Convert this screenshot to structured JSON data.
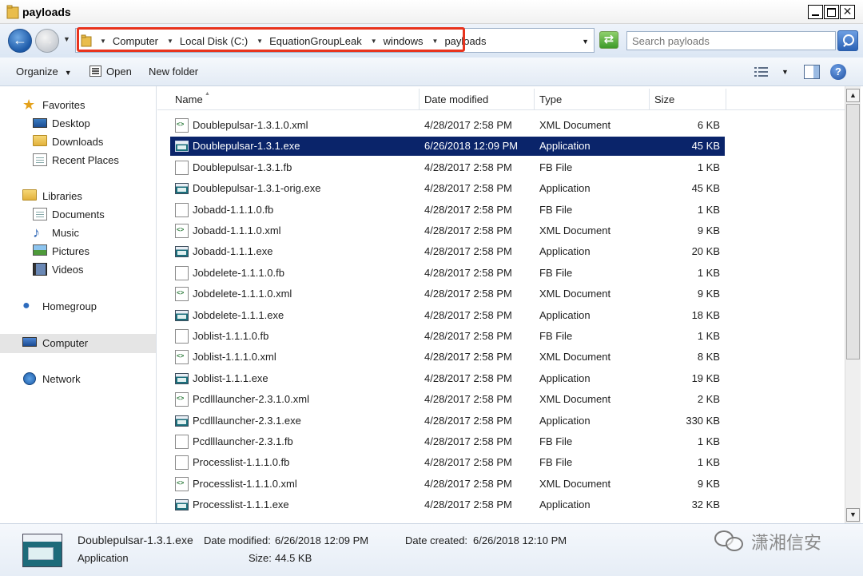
{
  "window": {
    "title": "payloads"
  },
  "address": {
    "crumbs": [
      "Computer",
      "Local Disk (C:)",
      "EquationGroupLeak",
      "windows",
      "payloads"
    ]
  },
  "search": {
    "placeholder": "Search payloads"
  },
  "toolbar": {
    "organize": "Organize",
    "open": "Open",
    "new_folder": "New folder"
  },
  "nav": {
    "favorites": "Favorites",
    "desktop": "Desktop",
    "downloads": "Downloads",
    "recent_places": "Recent Places",
    "libraries": "Libraries",
    "documents": "Documents",
    "music": "Music",
    "pictures": "Pictures",
    "videos": "Videos",
    "homegroup": "Homegroup",
    "computer": "Computer",
    "network": "Network"
  },
  "columns": {
    "name": "Name",
    "date": "Date modified",
    "type": "Type",
    "size": "Size"
  },
  "files": [
    {
      "name": "Doublepulsar-1.3.1.0.xml",
      "date": "4/28/2017 2:58 PM",
      "type": "XML Document",
      "size": "6 KB",
      "kind": "xml",
      "selected": false
    },
    {
      "name": "Doublepulsar-1.3.1.exe",
      "date": "6/26/2018 12:09 PM",
      "type": "Application",
      "size": "45 KB",
      "kind": "exe",
      "selected": true
    },
    {
      "name": "Doublepulsar-1.3.1.fb",
      "date": "4/28/2017 2:58 PM",
      "type": "FB File",
      "size": "1 KB",
      "kind": "fb",
      "selected": false
    },
    {
      "name": "Doublepulsar-1.3.1-orig.exe",
      "date": "4/28/2017 2:58 PM",
      "type": "Application",
      "size": "45 KB",
      "kind": "exe",
      "selected": false
    },
    {
      "name": "Jobadd-1.1.1.0.fb",
      "date": "4/28/2017 2:58 PM",
      "type": "FB File",
      "size": "1 KB",
      "kind": "fb",
      "selected": false
    },
    {
      "name": "Jobadd-1.1.1.0.xml",
      "date": "4/28/2017 2:58 PM",
      "type": "XML Document",
      "size": "9 KB",
      "kind": "xml",
      "selected": false
    },
    {
      "name": "Jobadd-1.1.1.exe",
      "date": "4/28/2017 2:58 PM",
      "type": "Application",
      "size": "20 KB",
      "kind": "exe",
      "selected": false
    },
    {
      "name": "Jobdelete-1.1.1.0.fb",
      "date": "4/28/2017 2:58 PM",
      "type": "FB File",
      "size": "1 KB",
      "kind": "fb",
      "selected": false
    },
    {
      "name": "Jobdelete-1.1.1.0.xml",
      "date": "4/28/2017 2:58 PM",
      "type": "XML Document",
      "size": "9 KB",
      "kind": "xml",
      "selected": false
    },
    {
      "name": "Jobdelete-1.1.1.exe",
      "date": "4/28/2017 2:58 PM",
      "type": "Application",
      "size": "18 KB",
      "kind": "exe",
      "selected": false
    },
    {
      "name": "Joblist-1.1.1.0.fb",
      "date": "4/28/2017 2:58 PM",
      "type": "FB File",
      "size": "1 KB",
      "kind": "fb",
      "selected": false
    },
    {
      "name": "Joblist-1.1.1.0.xml",
      "date": "4/28/2017 2:58 PM",
      "type": "XML Document",
      "size": "8 KB",
      "kind": "xml",
      "selected": false
    },
    {
      "name": "Joblist-1.1.1.exe",
      "date": "4/28/2017 2:58 PM",
      "type": "Application",
      "size": "19 KB",
      "kind": "exe",
      "selected": false
    },
    {
      "name": "Pcdlllauncher-2.3.1.0.xml",
      "date": "4/28/2017 2:58 PM",
      "type": "XML Document",
      "size": "2 KB",
      "kind": "xml",
      "selected": false
    },
    {
      "name": "Pcdlllauncher-2.3.1.exe",
      "date": "4/28/2017 2:58 PM",
      "type": "Application",
      "size": "330 KB",
      "kind": "exe",
      "selected": false
    },
    {
      "name": "Pcdlllauncher-2.3.1.fb",
      "date": "4/28/2017 2:58 PM",
      "type": "FB File",
      "size": "1 KB",
      "kind": "fb",
      "selected": false
    },
    {
      "name": "Processlist-1.1.1.0.fb",
      "date": "4/28/2017 2:58 PM",
      "type": "FB File",
      "size": "1 KB",
      "kind": "fb",
      "selected": false
    },
    {
      "name": "Processlist-1.1.1.0.xml",
      "date": "4/28/2017 2:58 PM",
      "type": "XML Document",
      "size": "9 KB",
      "kind": "xml",
      "selected": false
    },
    {
      "name": "Processlist-1.1.1.exe",
      "date": "4/28/2017 2:58 PM",
      "type": "Application",
      "size": "32 KB",
      "kind": "exe",
      "selected": false
    }
  ],
  "details": {
    "filename": "Doublepulsar-1.3.1.exe",
    "type": "Application",
    "modified_label": "Date modified:",
    "modified_value": "6/26/2018 12:09 PM",
    "size_label": "Size:",
    "size_value": "44.5 KB",
    "created_label": "Date created:",
    "created_value": "6/26/2018 12:10 PM"
  },
  "watermark": {
    "text": "潇湘信安"
  },
  "colors": {
    "selection": "#0a246a",
    "highlight_border": "#e8331d"
  }
}
